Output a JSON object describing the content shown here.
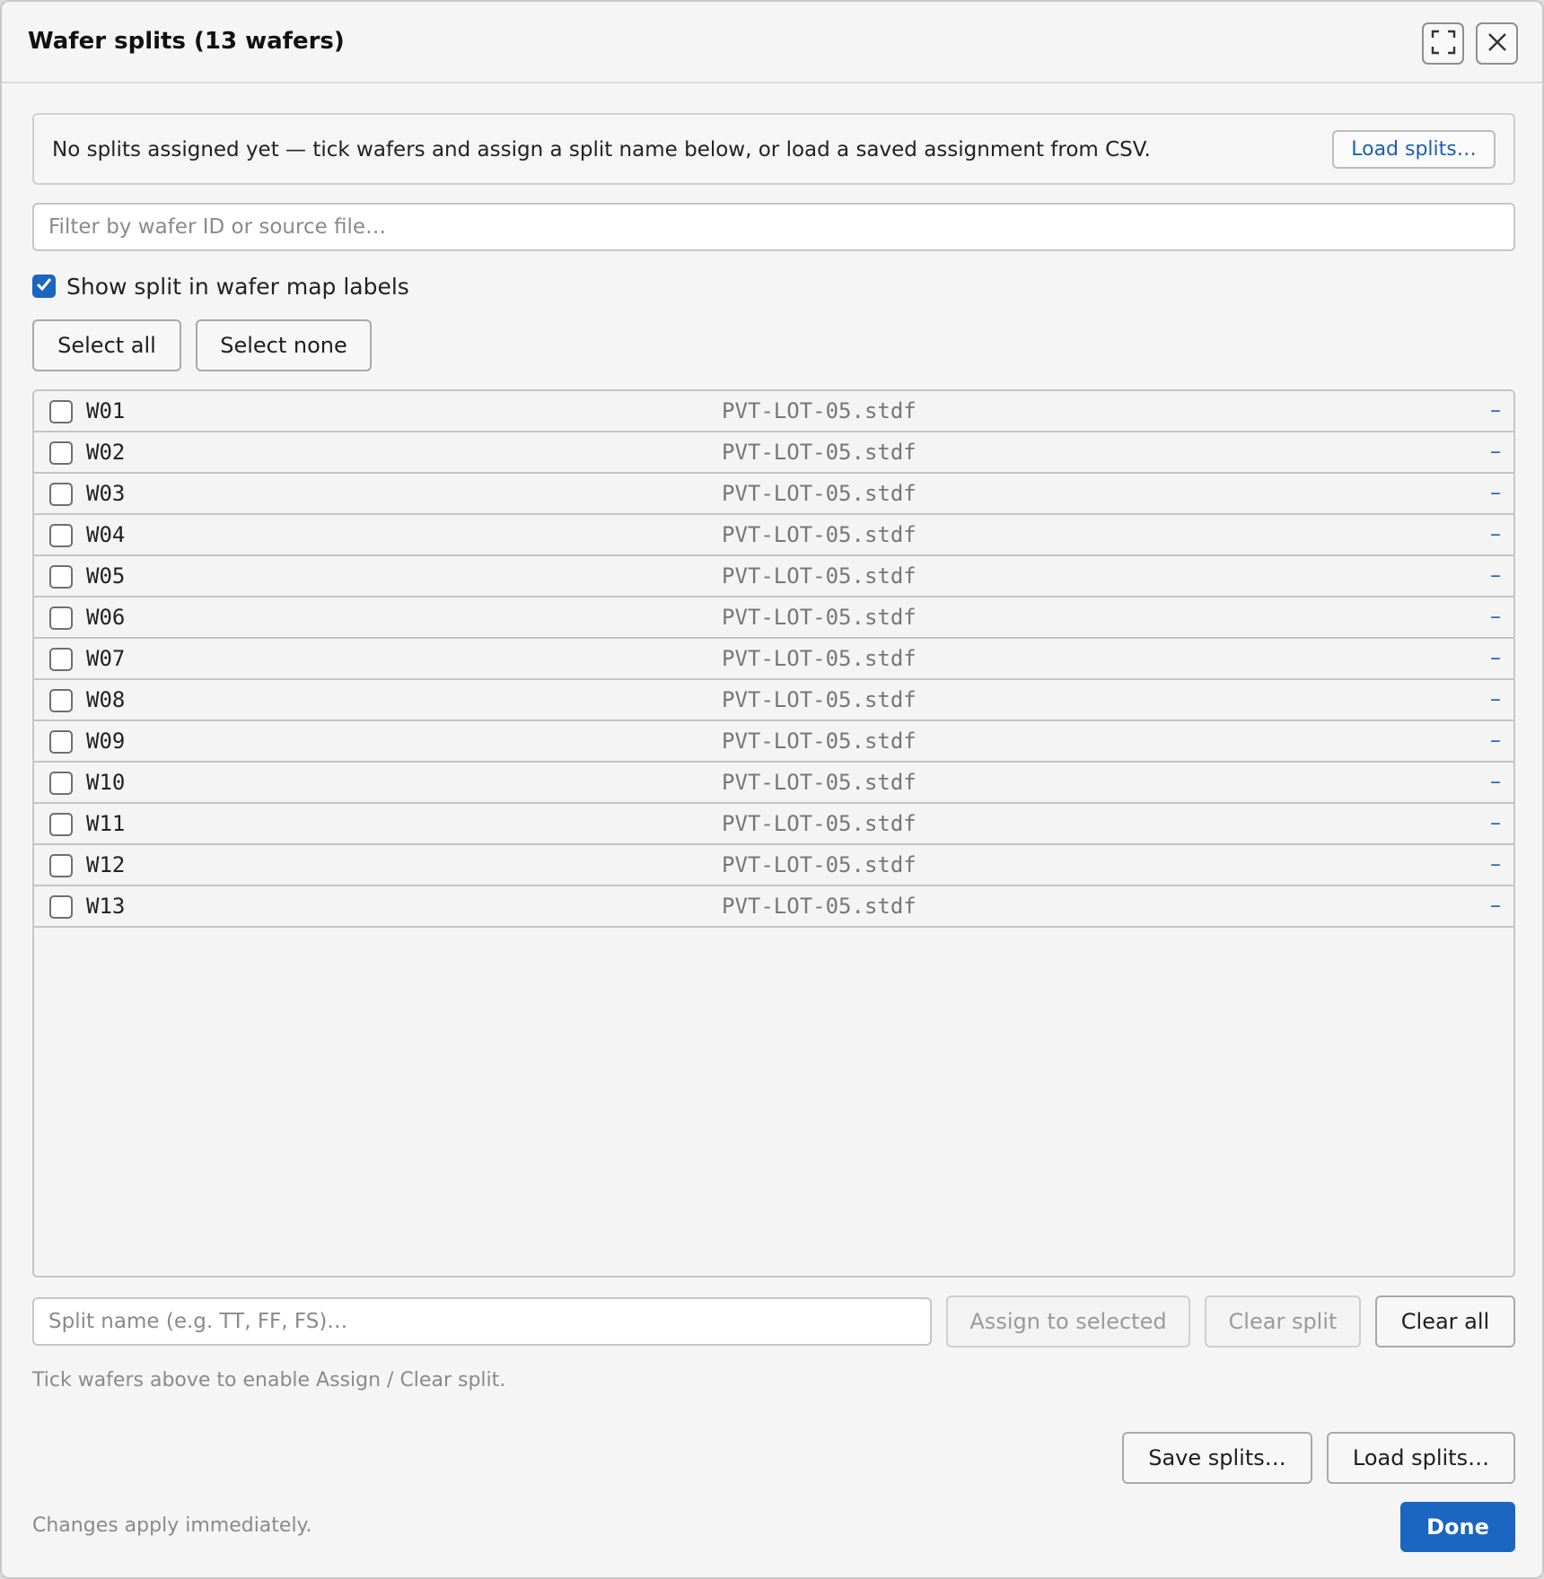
{
  "dialog": {
    "title": "Wafer splits (13 wafers)",
    "maximize_icon": "maximize-icon",
    "close_icon": "close-icon"
  },
  "banner": {
    "text": "No splits assigned yet — tick wafers and assign a split name below, or load a saved assignment from CSV.",
    "load_button": "Load splits…"
  },
  "filter": {
    "placeholder": "Filter by wafer ID or source file…",
    "value": ""
  },
  "show_split": {
    "label": "Show split in wafer map labels",
    "checked": true
  },
  "selection": {
    "select_all": "Select all",
    "select_none": "Select none"
  },
  "wafers": [
    {
      "id": "W01",
      "source": "PVT-LOT-05.stdf",
      "split": "–"
    },
    {
      "id": "W02",
      "source": "PVT-LOT-05.stdf",
      "split": "–"
    },
    {
      "id": "W03",
      "source": "PVT-LOT-05.stdf",
      "split": "–"
    },
    {
      "id": "W04",
      "source": "PVT-LOT-05.stdf",
      "split": "–"
    },
    {
      "id": "W05",
      "source": "PVT-LOT-05.stdf",
      "split": "–"
    },
    {
      "id": "W06",
      "source": "PVT-LOT-05.stdf",
      "split": "–"
    },
    {
      "id": "W07",
      "source": "PVT-LOT-05.stdf",
      "split": "–"
    },
    {
      "id": "W08",
      "source": "PVT-LOT-05.stdf",
      "split": "–"
    },
    {
      "id": "W09",
      "source": "PVT-LOT-05.stdf",
      "split": "–"
    },
    {
      "id": "W10",
      "source": "PVT-LOT-05.stdf",
      "split": "–"
    },
    {
      "id": "W11",
      "source": "PVT-LOT-05.stdf",
      "split": "–"
    },
    {
      "id": "W12",
      "source": "PVT-LOT-05.stdf",
      "split": "–"
    },
    {
      "id": "W13",
      "source": "PVT-LOT-05.stdf",
      "split": "–"
    }
  ],
  "assign": {
    "placeholder": "Split name (e.g. TT, FF, FS)…",
    "assign_button": "Assign to selected",
    "clear_split_button": "Clear split",
    "clear_all_button": "Clear all",
    "hint": "Tick wafers above to enable Assign / Clear split."
  },
  "footer": {
    "save_button": "Save splits…",
    "load_button": "Load splits…",
    "note": "Changes apply immediately.",
    "done_button": "Done"
  },
  "colors": {
    "accent": "#1b66c0",
    "background": "#f5f5f5",
    "muted_text": "#8a8a8a"
  }
}
